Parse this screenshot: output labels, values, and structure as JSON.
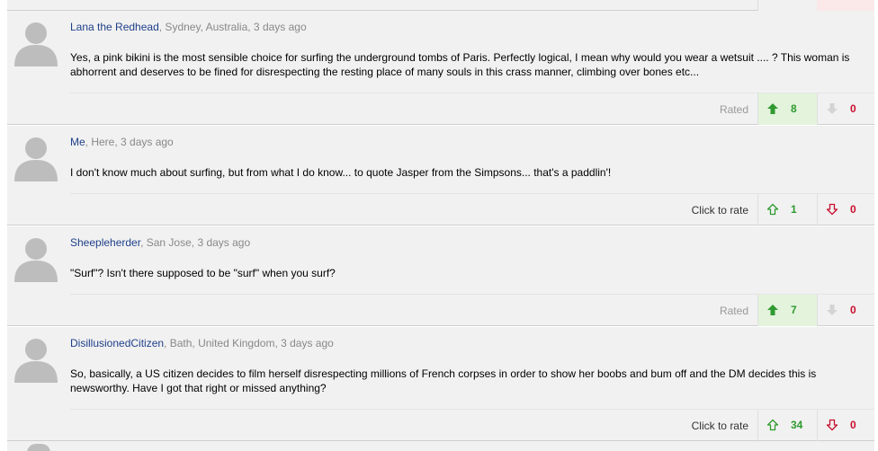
{
  "comments": [
    {
      "author": "Lana the Redhead",
      "details": ", Sydney, Australia, 3 days ago",
      "text": "Yes, a pink bikini is the most sensible choice for surfing the underground tombs of Paris. Perfectly logical, I mean why would you wear a wetsuit .... ? This woman is abhorrent and deserves to be fined for disrespecting the resting place of many souls in this crass manner, climbing over bones etc...",
      "rate_label": "Rated",
      "up_count": "8",
      "down_count": "0"
    },
    {
      "author": "Me",
      "details": ", Here, 3 days ago",
      "text": "I don't know much about surfing, but from what I do know... to quote Jasper from the Simpsons... that's a paddlin'!",
      "rate_label": "Click to rate",
      "up_count": "1",
      "down_count": "0"
    },
    {
      "author": "Sheepleherder",
      "details": ", San Jose, 3 days ago",
      "text": "\"Surf\"? Isn't there supposed to be \"surf\" when you surf?",
      "rate_label": "Rated",
      "up_count": "7",
      "down_count": "0"
    },
    {
      "author": "DisillusionedCitizen",
      "details": ", Bath, United Kingdom, 3 days ago",
      "text": "So, basically, a US citizen decides to film herself disrespecting millions of French corpses in order to show her boobs and bum off and the DM decides this is newsworthy. Have I got that right or missed anything?",
      "rate_label": "Click to rate",
      "up_count": "34",
      "down_count": "0"
    }
  ],
  "colors": {
    "author_link": "#1e3f8a",
    "up_green": "#2f9a2f",
    "down_red": "#c8102e",
    "rated_bg": "#e3f3dc",
    "card_bg": "#f1f1f1"
  },
  "icons": {
    "avatar": "default-user-silhouette-icon",
    "up": "arrow-up-icon",
    "down": "arrow-down-icon"
  }
}
